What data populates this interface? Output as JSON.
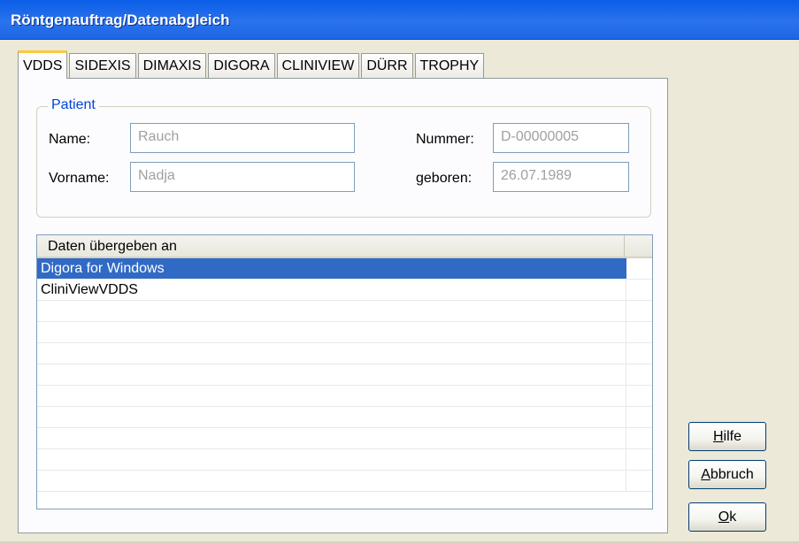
{
  "window": {
    "title": "Röntgenauftrag/Datenabgleich"
  },
  "tabs": [
    {
      "label": "VDDS",
      "active": true
    },
    {
      "label": "SIDEXIS",
      "active": false
    },
    {
      "label": "DIMAXIS",
      "active": false
    },
    {
      "label": "DIGORA",
      "active": false
    },
    {
      "label": "CLINIVIEW",
      "active": false
    },
    {
      "label": "DÜRR",
      "active": false
    },
    {
      "label": "TROPHY",
      "active": false
    }
  ],
  "patient": {
    "group_label": "Patient",
    "name_label": "Name:",
    "name_value": "Rauch",
    "vorname_label": "Vorname:",
    "vorname_value": "Nadja",
    "nummer_label": "Nummer:",
    "nummer_value": "D-00000005",
    "geboren_label": "geboren:",
    "geboren_value": "26.07.1989"
  },
  "list": {
    "header": "Daten übergeben an",
    "rows": [
      "Digora for Windows",
      "CliniViewVDDS"
    ],
    "selected_index": 0
  },
  "buttons": {
    "hilfe": {
      "mnemonic": "H",
      "rest": "ilfe"
    },
    "abbruch": {
      "mnemonic": "A",
      "rest": "bbruch"
    },
    "ok": {
      "mnemonic": "O",
      "rest": "k"
    }
  },
  "colors": {
    "titlebar": "#1966e9",
    "selection": "#316ac5",
    "group_label": "#0046d5",
    "active_tab_accent": "#ffc83c"
  }
}
